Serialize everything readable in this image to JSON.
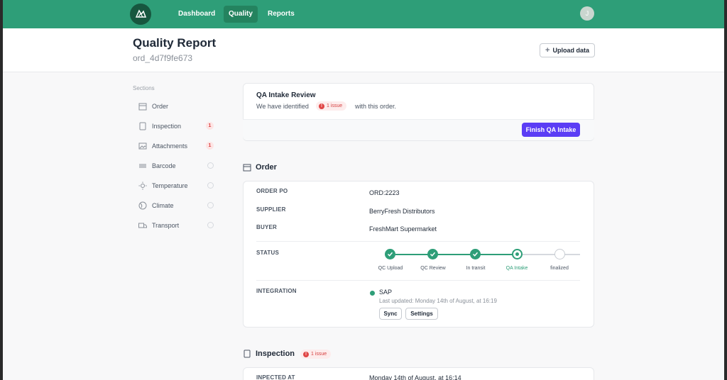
{
  "nav": {
    "items": [
      "Dashboard",
      "Quality",
      "Reports"
    ],
    "active": "Quality",
    "avatar_initial": "J"
  },
  "header": {
    "title": "Quality Report",
    "order_id": "ord_4d7f9fe673",
    "upload_label": "Upload data"
  },
  "sidebar": {
    "label": "Sections",
    "items": [
      {
        "label": "Order",
        "icon": "building-icon",
        "badge": ""
      },
      {
        "label": "Inspection",
        "icon": "clipboard-icon",
        "badge": "1"
      },
      {
        "label": "Attachments",
        "icon": "image-icon",
        "badge": "1"
      },
      {
        "label": "Barcode",
        "icon": "barcode-icon",
        "badge": ""
      },
      {
        "label": "Temperature",
        "icon": "sun-icon",
        "badge": ""
      },
      {
        "label": "Climate",
        "icon": "globe-icon",
        "badge": ""
      },
      {
        "label": "Transport",
        "icon": "truck-icon",
        "badge": ""
      }
    ]
  },
  "qa_intake": {
    "title": "QA Intake Review",
    "sub_before": "We have identified",
    "issue_label": "1 issue",
    "sub_after": "with this order.",
    "finish_label": "Finish QA Intake"
  },
  "order": {
    "heading": "Order",
    "fields": [
      {
        "label": "ORDER PO",
        "value": "ORD:2223"
      },
      {
        "label": "SUPPLIER",
        "value": "BerryFresh Distributors"
      },
      {
        "label": "BUYER",
        "value": "FreshMart Supermarket"
      }
    ],
    "status_label": "STATUS",
    "steps": [
      {
        "label": "QC Upload",
        "state": "done"
      },
      {
        "label": "QC Review",
        "state": "done"
      },
      {
        "label": "In transit",
        "state": "done"
      },
      {
        "label": "QA Intake",
        "state": "current"
      },
      {
        "label": "finalized",
        "state": "pending"
      }
    ],
    "integration_label": "INTEGRATION",
    "integration_name": "SAP",
    "integration_updated": "Last updated: Monday 14th of August, at 16:19",
    "sync_label": "Sync",
    "settings_label": "Settings"
  },
  "inspection": {
    "heading": "Inspection",
    "issue_label": "1 issue",
    "row_label": "INPECTED AT",
    "row_value": "Monday 14th of August, at 16:14"
  },
  "colors": {
    "brand": "#2e9e78",
    "accent": "#5b3df5",
    "issue": "#e04545"
  }
}
